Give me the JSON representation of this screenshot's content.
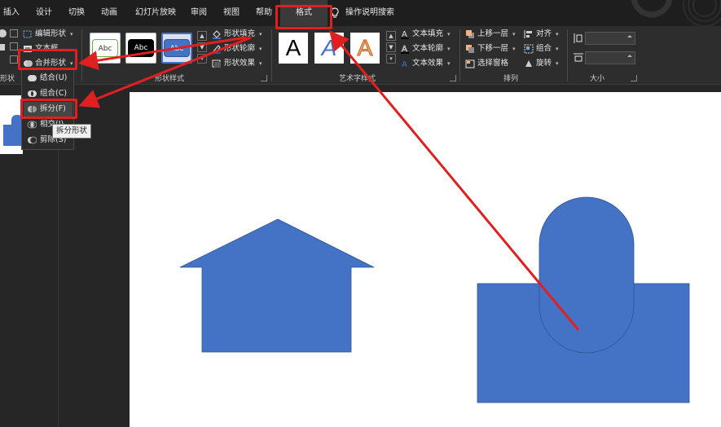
{
  "tabs": [
    {
      "id": "insert",
      "label": "插入"
    },
    {
      "id": "design",
      "label": "设计"
    },
    {
      "id": "transitions",
      "label": "切换"
    },
    {
      "id": "animations",
      "label": "动画"
    },
    {
      "id": "slideshow",
      "label": "幻灯片放映"
    },
    {
      "id": "review",
      "label": "审阅"
    },
    {
      "id": "view",
      "label": "视图"
    },
    {
      "id": "help",
      "label": "帮助"
    },
    {
      "id": "format",
      "label": "格式"
    }
  ],
  "tell_me": {
    "label": "操作说明搜索",
    "icon": "lightbulb-icon"
  },
  "ribbon": {
    "insert_shapes": {
      "edit_shape": "编辑形状",
      "text_box": "文本框",
      "merge_shapes": "合并形状",
      "group_label_partial": "形状"
    },
    "shape_styles": {
      "group_label": "形状样式",
      "preset_text": "Abc",
      "fill": "形状填充",
      "outline": "形状轮廓",
      "effects": "形状效果"
    },
    "wordart_styles": {
      "group_label": "艺术字样式",
      "sample": "A",
      "text_fill": "文本填充",
      "text_outline": "文本轮廓",
      "text_effects": "文本效果"
    },
    "arrange": {
      "group_label": "排列",
      "bring_forward": "上移一层",
      "send_backward": "下移一层",
      "selection_pane": "选择窗格",
      "align": "对齐",
      "group": "组合",
      "rotate": "旋转"
    },
    "size": {
      "group_label": "大小"
    }
  },
  "merge_menu": {
    "items": [
      {
        "label": "结合(U)",
        "icon": "union-icon"
      },
      {
        "label": "组合(C)",
        "icon": "combine-icon"
      },
      {
        "label": "拆分(F)",
        "icon": "fragment-icon"
      },
      {
        "label": "相交(I)",
        "icon": "intersect-icon"
      },
      {
        "label": "剪除(S)",
        "icon": "subtract-icon"
      }
    ],
    "selected_index": 2,
    "tooltip": "拆分形状"
  },
  "colors": {
    "shape_fill": "#4472c4",
    "annotation_red": "#e02020",
    "ribbon_bg": "#2d2d2d",
    "tabbar_bg": "#1e1e1e"
  }
}
